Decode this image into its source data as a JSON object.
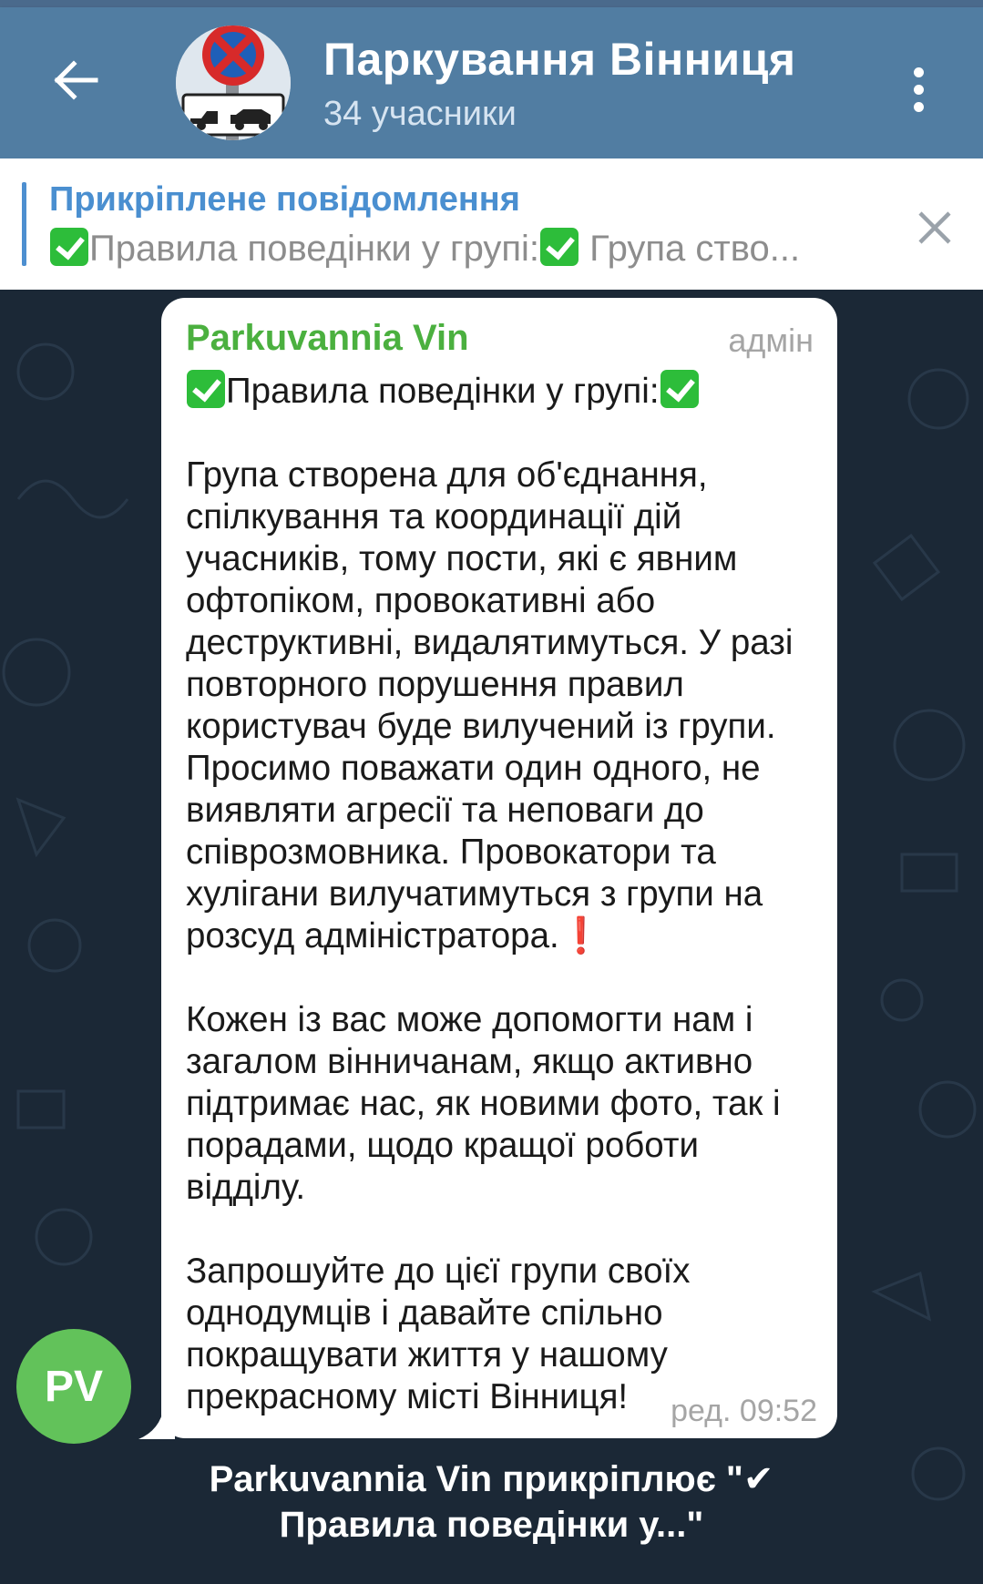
{
  "header": {
    "title": "Паркування Вінниця",
    "subtitle": "34 учасники"
  },
  "pinned": {
    "title": "Прикріплене повідомлення",
    "text_a": "Правила поведінки у групі:",
    "text_b": " Група ство..."
  },
  "message": {
    "sender": "Parkuvannia Vin",
    "role": "адмін",
    "heading": "Правила поведінки у групі:",
    "body_1": "Група створена для об'єднання, спілкування та координації дій учасників, тому пости, які є явним офтопіком, провокативні або деструктивні, видалятимуться. У разі повторного порушення правил користувач буде вилучений із групи. Просимо поважати один одного, не виявляти агресії та неповаги до співрозмовника. Провокатори та хулігани вилучатимуться з групи на розсуд адміністратора.",
    "excl": "❗",
    "body_2": "Кожен із вас може допомогти нам і загалом вінничанам, якщо активно підтримає нас, як новими фото, так і порадами, щодо кращої роботи відділу.",
    "body_3": "Запрошуйте до цієї групи своїх однодумців і давайте спільно покращувати життя у нашому прекрасному місті Вінниця!",
    "time": "ред. 09:52"
  },
  "sender_avatar": {
    "initials": "PV",
    "color": "#62c25a"
  },
  "service_message": {
    "text_a": "Parkuvannia Vin прикріплює \"",
    "check": "✔",
    "text_b": "Правила поведінки у...\""
  },
  "colors": {
    "header": "#517da2",
    "accent": "#4a8fd0",
    "sender": "#4bb03f",
    "chat_bg": "#1b2836"
  },
  "icons": {
    "back": "arrow-left-icon",
    "menu": "more-vertical-icon",
    "close": "close-icon",
    "check": "check-mark-emoji-icon"
  }
}
